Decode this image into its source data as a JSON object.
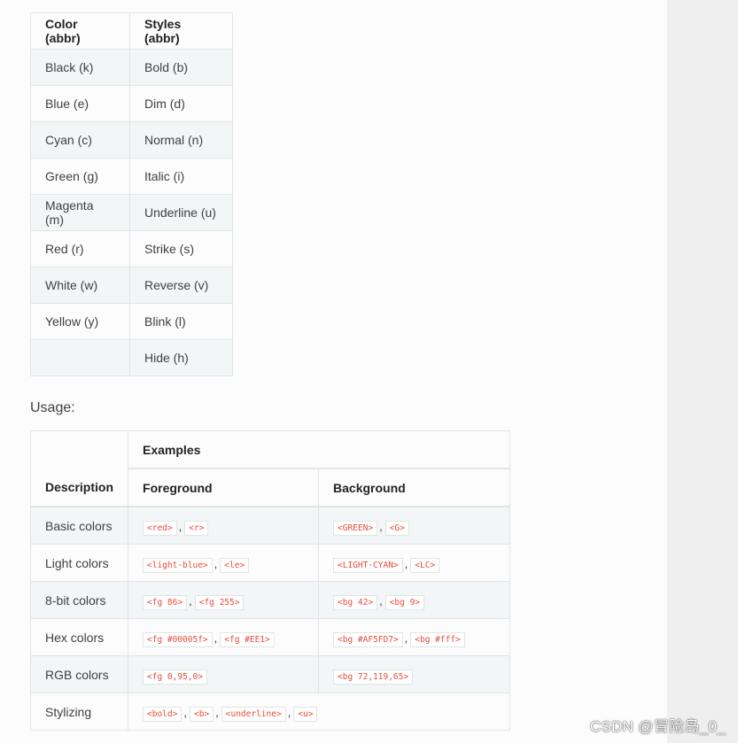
{
  "abbr_table": {
    "headers": [
      "Color (abbr)",
      "Styles (abbr)"
    ],
    "rows": [
      [
        "Black (k)",
        "Bold (b)"
      ],
      [
        "Blue (e)",
        "Dim (d)"
      ],
      [
        "Cyan (c)",
        "Normal (n)"
      ],
      [
        "Green (g)",
        "Italic (i)"
      ],
      [
        "Magenta (m)",
        "Underline (u)"
      ],
      [
        "Red (r)",
        "Strike (s)"
      ],
      [
        "White (w)",
        "Reverse (v)"
      ],
      [
        "Yellow (y)",
        "Blink (l)"
      ],
      [
        "",
        "Hide (h)"
      ]
    ]
  },
  "usage_label": "Usage:",
  "usage_table": {
    "description_header": "Description",
    "examples_header": "Examples",
    "foreground_header": "Foreground",
    "background_header": "Background",
    "separator": ",",
    "rows": [
      {
        "desc": "Basic colors",
        "fg": [
          "<red>",
          "<r>"
        ],
        "bg": [
          "<GREEN>",
          "<G>"
        ]
      },
      {
        "desc": "Light colors",
        "fg": [
          "<light-blue>",
          "<le>"
        ],
        "bg": [
          "<LIGHT-CYAN>",
          "<LC>"
        ]
      },
      {
        "desc": "8-bit colors",
        "fg": [
          "<fg 86>",
          "<fg 255>"
        ],
        "bg": [
          "<bg 42>",
          "<bg 9>"
        ]
      },
      {
        "desc": "Hex colors",
        "fg": [
          "<fg #00005f>",
          "<fg #EE1>"
        ],
        "bg": [
          "<bg #AF5FD7>",
          "<bg #fff>"
        ]
      },
      {
        "desc": "RGB colors",
        "fg": [
          "<fg 0,95,0>"
        ],
        "bg": [
          "<bg 72,119,65>"
        ]
      }
    ],
    "styling_row": {
      "desc": "Stylizing",
      "codes": [
        "<bold>",
        "<b>",
        "<underline>",
        "<u>"
      ]
    }
  },
  "watermark": "CSDN @冒险岛_0_",
  "colors": {
    "code_text": "#e74c3c",
    "border": "#e1e4e5",
    "stripe": "#f3f6f6"
  }
}
